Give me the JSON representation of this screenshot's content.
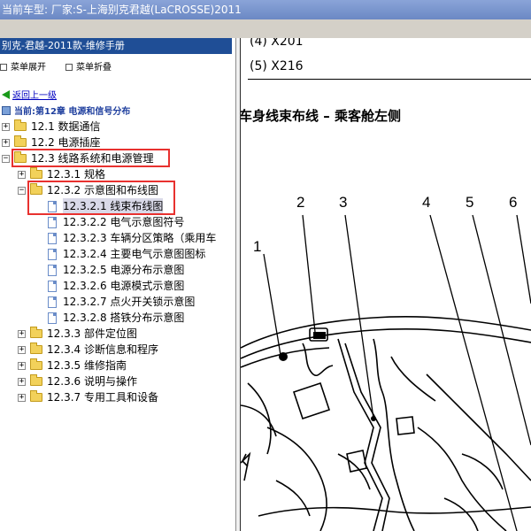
{
  "window": {
    "title": "当前车型:  厂家:S-上海别克君越(LaCROSSE)2011"
  },
  "sidebar": {
    "header": "别克-君越-2011款-维修手册",
    "expand_label": "菜单展开",
    "collapse_label": "菜单折叠",
    "back_label": "返回上一级",
    "current_label": "当前:第12章 电源和信号分布",
    "tree": [
      {
        "label": "12.1 数据通信",
        "expander": "+"
      },
      {
        "label": "12.2 电源插座",
        "expander": "+"
      },
      {
        "label": "12.3 线路系统和电源管理",
        "expander": "−"
      },
      {
        "label": "12.3.1 规格",
        "expander": "+"
      },
      {
        "label": "12.3.2 示意图和布线图",
        "expander": "−"
      },
      {
        "label": "12.3.2.1 线束布线图"
      },
      {
        "label": "12.3.2.2 电气示意图符号"
      },
      {
        "label": "12.3.2.3 车辆分区策略（乘用车"
      },
      {
        "label": "12.3.2.4 主要电气示意图图标"
      },
      {
        "label": "12.3.2.5 电源分布示意图"
      },
      {
        "label": "12.3.2.6 电源模式示意图"
      },
      {
        "label": "12.3.2.7 点火开关锁示意图"
      },
      {
        "label": "12.3.2.8 搭铁分布示意图"
      },
      {
        "label": "12.3.3 部件定位图",
        "expander": "+"
      },
      {
        "label": "12.3.4 诊断信息和程序",
        "expander": "+"
      },
      {
        "label": "12.3.5 维修指南",
        "expander": "+"
      },
      {
        "label": "12.3.6 说明与操作",
        "expander": "+"
      },
      {
        "label": "12.3.7 专用工具和设备",
        "expander": "+"
      }
    ]
  },
  "content": {
    "connector_items": [
      "(4) X201",
      "(5) X216"
    ],
    "diagram_title": "车身线束布线 – 乘客舱左侧",
    "callouts": [
      "1",
      "2",
      "3",
      "4",
      "5",
      "6"
    ]
  },
  "colors": {
    "highlight_box": "#e8312f",
    "sidebar_header": "#1f4e96",
    "title_bar": "#6b88c4"
  }
}
